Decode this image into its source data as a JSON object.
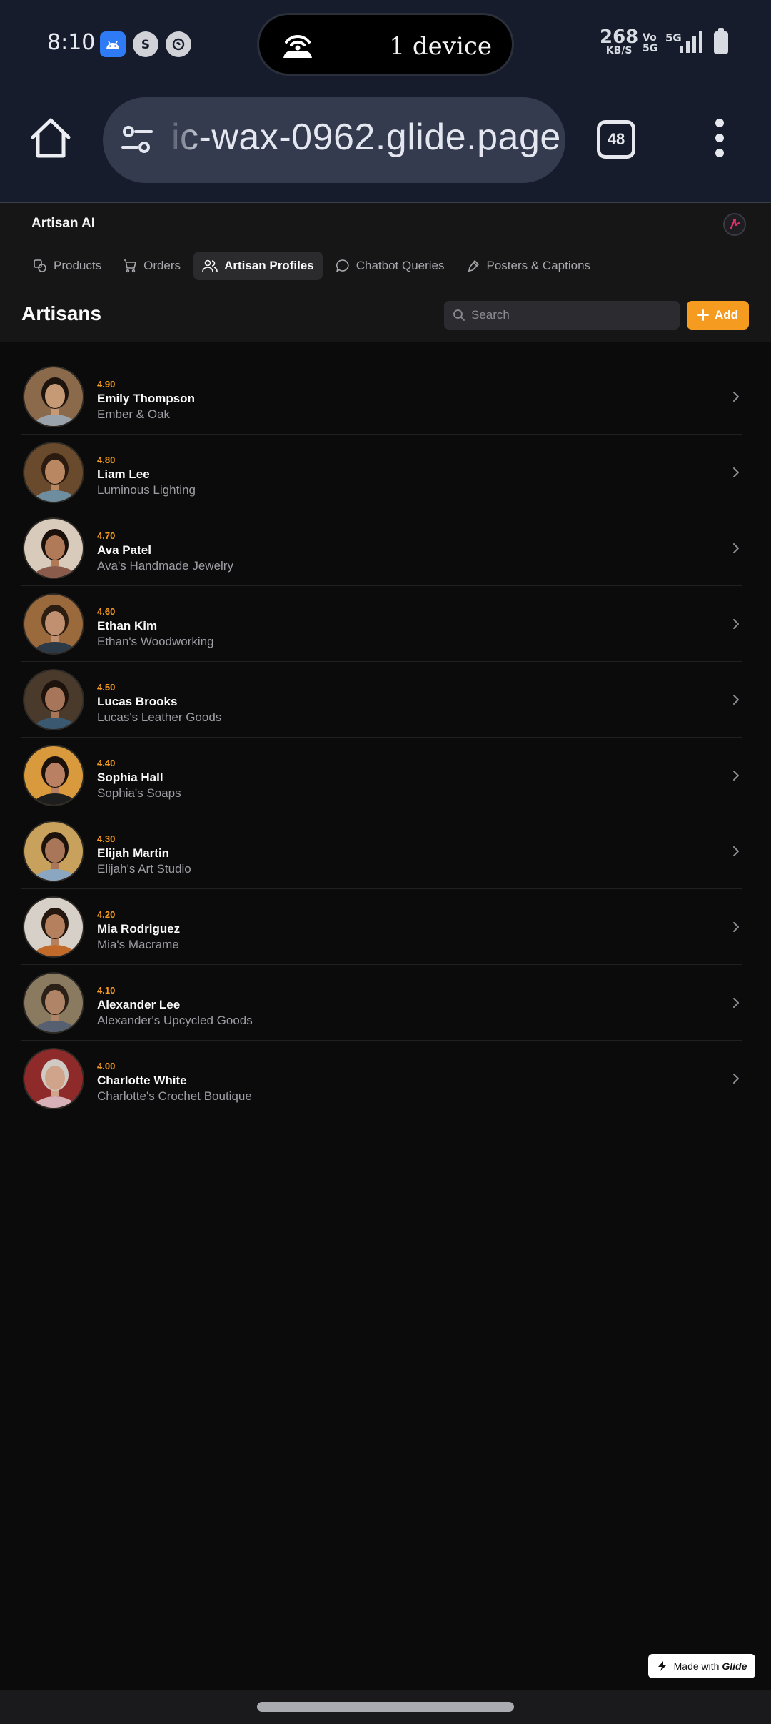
{
  "status": {
    "time": "8:10",
    "hotspot_text": "1 device",
    "net_speed": "268",
    "net_unit": "KB/S",
    "volte": "Vo\n5G",
    "network": "5G"
  },
  "browser": {
    "url": "ic-wax-0962.glide.page",
    "tab_count": "48"
  },
  "app": {
    "name": "Artisan AI",
    "tabs": [
      {
        "label": "Products",
        "icon": "products-icon",
        "active": false
      },
      {
        "label": "Orders",
        "icon": "cart-icon",
        "active": false
      },
      {
        "label": "Artisan Profiles",
        "icon": "users-icon",
        "active": true
      },
      {
        "label": "Chatbot Queries",
        "icon": "chat-bubble-icon",
        "active": false
      },
      {
        "label": "Posters & Captions",
        "icon": "pen-icon",
        "active": false
      }
    ],
    "page_title": "Artisans",
    "search_placeholder": "Search",
    "add_label": "Add",
    "accent": "#f59b1f"
  },
  "artisans": [
    {
      "rating": "4.90",
      "name": "Emily Thompson",
      "shop": "Ember & Oak",
      "bg": "#8a6a4a",
      "skin": "#c79a76",
      "hair": "#1e140e",
      "shirt": "#9aa3ab"
    },
    {
      "rating": "4.80",
      "name": "Liam Lee",
      "shop": "Luminous Lighting",
      "bg": "#6a4a2c",
      "skin": "#b98863",
      "hair": "#2a1a10",
      "shirt": "#6e8ea0"
    },
    {
      "rating": "4.70",
      "name": "Ava Patel",
      "shop": "Ava's Handmade Jewelry",
      "bg": "#d8cbbb",
      "skin": "#b07a58",
      "hair": "#1a100b",
      "shirt": "#8a5a4a"
    },
    {
      "rating": "4.60",
      "name": "Ethan Kim",
      "shop": "Ethan's Woodworking",
      "bg": "#9a6a3c",
      "skin": "#c09070",
      "hair": "#2b1d12",
      "shirt": "#2c3a48"
    },
    {
      "rating": "4.50",
      "name": "Lucas Brooks",
      "shop": "Lucas's Leather Goods",
      "bg": "#4a3a2c",
      "skin": "#a7765a",
      "hair": "#1d130c",
      "shirt": "#3a5870"
    },
    {
      "rating": "4.40",
      "name": "Sophia Hall",
      "shop": "Sophia's Soaps",
      "bg": "#d89a3c",
      "skin": "#b98064",
      "hair": "#1a110c",
      "shirt": "#1e1e1e"
    },
    {
      "rating": "4.30",
      "name": "Elijah Martin",
      "shop": "Elijah's Art Studio",
      "bg": "#c8a25c",
      "skin": "#a9765a",
      "hair": "#1c120c",
      "shirt": "#8aa6c0"
    },
    {
      "rating": "4.20",
      "name": "Mia Rodriguez",
      "shop": "Mia's Macrame",
      "bg": "#d6d0c8",
      "skin": "#b4805e",
      "hair": "#231710",
      "shirt": "#c26a2a"
    },
    {
      "rating": "4.10",
      "name": "Alexander Lee",
      "shop": "Alexander's Upcycled Goods",
      "bg": "#8a7a60",
      "skin": "#b08466",
      "hair": "#2a2018",
      "shirt": "#566070"
    },
    {
      "rating": "4.00",
      "name": "Charlotte White",
      "shop": "Charlotte's Crochet Boutique",
      "bg": "#8e2a2a",
      "skin": "#d0a48a",
      "hair": "#cfcac4",
      "shirt": "#d8b0b8"
    }
  ],
  "footer": {
    "made_with": "Made with",
    "brand": "Glide"
  }
}
